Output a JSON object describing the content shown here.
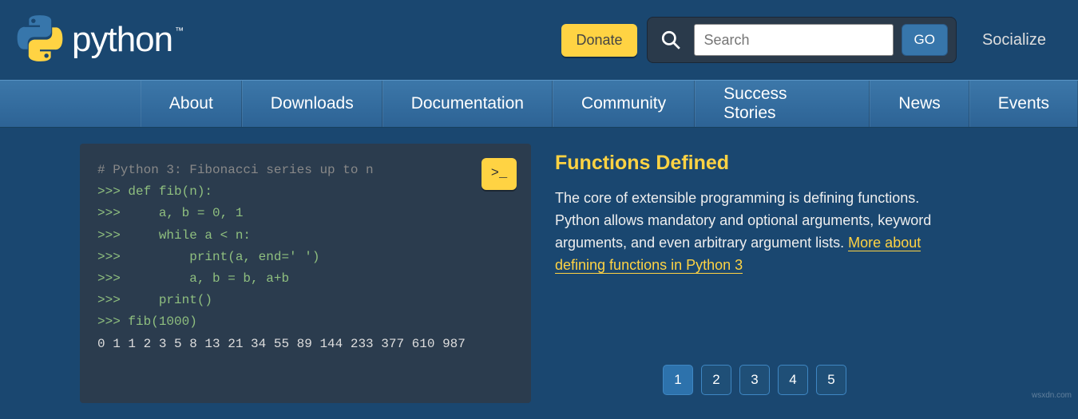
{
  "header": {
    "logo_text": "python",
    "tm": "™",
    "donate": "Donate",
    "search_placeholder": "Search",
    "go": "GO",
    "socialize": "Socialize"
  },
  "nav": {
    "about": "About",
    "downloads": "Downloads",
    "documentation": "Documentation",
    "community": "Community",
    "success": "Success Stories",
    "news": "News",
    "events": "Events"
  },
  "code": {
    "comment": "# Python 3: Fibonacci series up to n",
    "line1": ">>> def fib(n):",
    "line2": ">>>     a, b = 0, 1",
    "line3": ">>>     while a < n:",
    "line4": ">>>         print(a, end=' ')",
    "line5": ">>>         a, b = b, a+b",
    "line6": ">>>     print()",
    "line7": ">>> fib(1000)",
    "output": "0 1 1 2 3 5 8 13 21 34 55 89 144 233 377 610 987",
    "launch_label": ">_"
  },
  "info": {
    "title": "Functions Defined",
    "body": "The core of extensible programming is defining functions. Python allows mandatory and optional arguments, keyword arguments, and even arbitrary argument lists. ",
    "link_text": "More about defining functions in Python 3"
  },
  "pagination": {
    "p1": "1",
    "p2": "2",
    "p3": "3",
    "p4": "4",
    "p5": "5"
  },
  "watermark": "wsxdn.com"
}
